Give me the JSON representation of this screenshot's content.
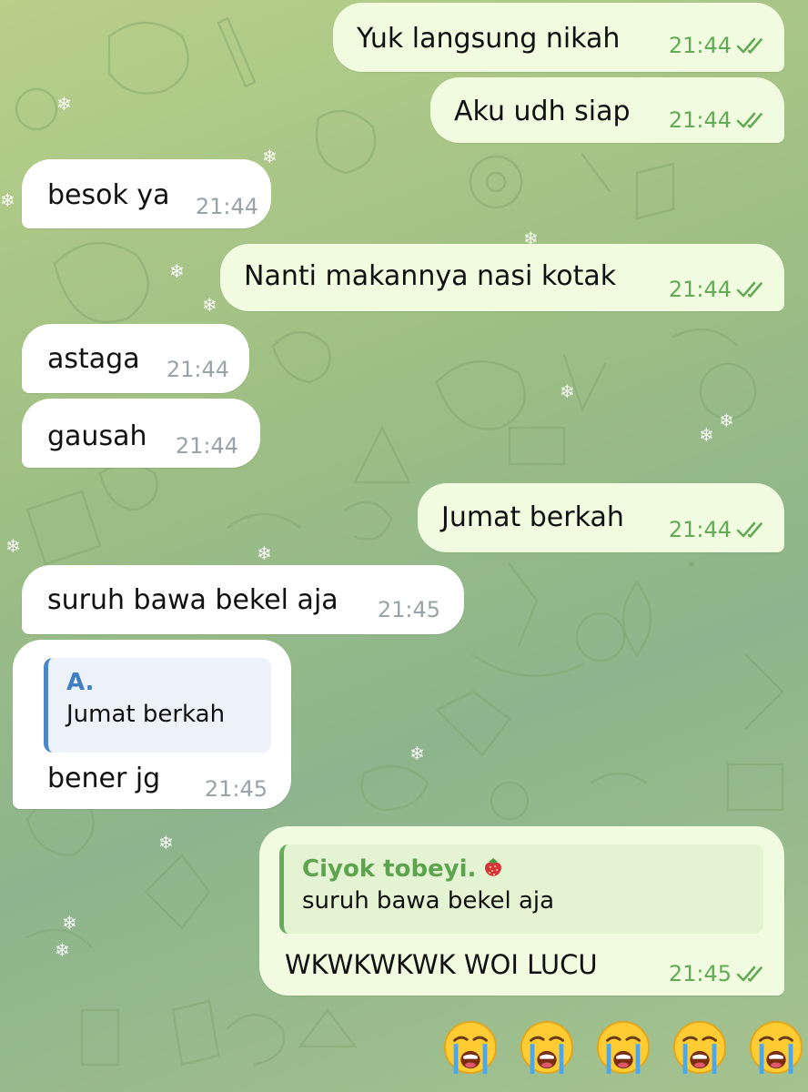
{
  "messages": [
    {
      "direction": "out",
      "text": "Yuk langsung nikah",
      "time": "21:44",
      "status": "read"
    },
    {
      "direction": "out",
      "text": "Aku udh siap",
      "time": "21:44",
      "status": "read"
    },
    {
      "direction": "in",
      "text": "besok ya",
      "time": "21:44"
    },
    {
      "direction": "out",
      "text": "Nanti makannya nasi kotak",
      "time": "21:44",
      "status": "read"
    },
    {
      "direction": "in",
      "text": "astaga",
      "time": "21:44"
    },
    {
      "direction": "in",
      "text": "gausah",
      "time": "21:44"
    },
    {
      "direction": "out",
      "text": "Jumat berkah",
      "time": "21:44",
      "status": "read"
    },
    {
      "direction": "in",
      "text": "suruh bawa bekel aja",
      "time": "21:45"
    },
    {
      "direction": "in",
      "reply_to": {
        "author": "A.",
        "text": "Jumat berkah"
      },
      "text": "bener jg",
      "time": "21:45"
    },
    {
      "direction": "out",
      "reply_to": {
        "author": "Ciyok tobeyi.",
        "author_emoji": "strawberry",
        "text": "suruh bawa bekel aja"
      },
      "text": "WKWKWKWK WOI LUCU",
      "time": "21:45",
      "status": "read"
    }
  ],
  "emoji_message": {
    "direction": "out",
    "emojis": [
      "loudly-crying-face",
      "loudly-crying-face",
      "loudly-crying-face",
      "loudly-crying-face",
      "loudly-crying-face"
    ]
  },
  "colors": {
    "outgoing_bubble": "#f1fbdf",
    "incoming_bubble": "#ffffff",
    "outgoing_meta": "#63aa56",
    "incoming_meta": "#9aa3a8",
    "incoming_reply_accent": "#4b86c9",
    "outgoing_reply_accent": "#67ab5d"
  }
}
